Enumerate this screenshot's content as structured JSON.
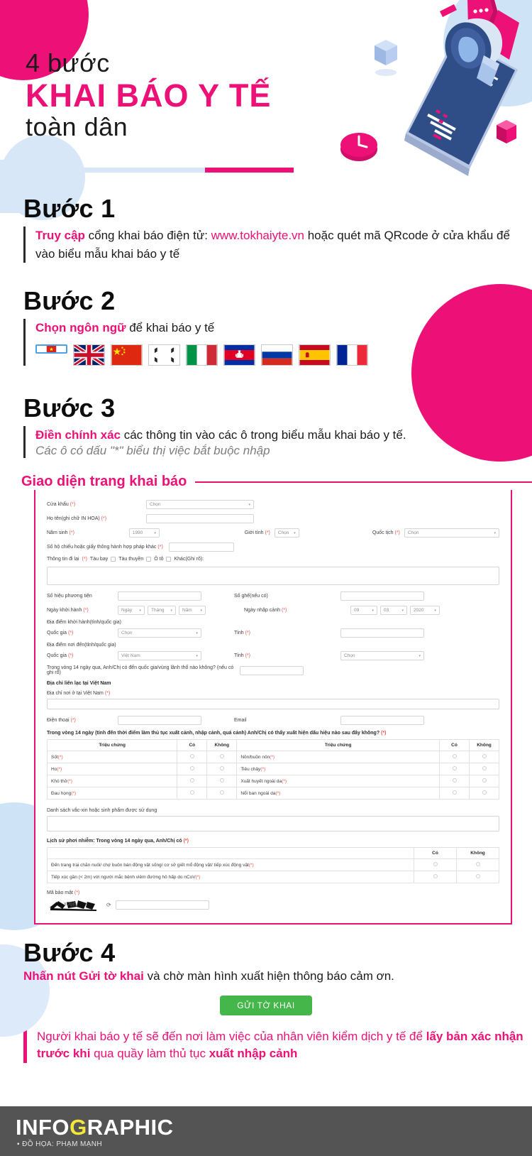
{
  "hero": {
    "line1": "4 bước",
    "line2": "KHAI BÁO Y TẾ",
    "line3": "toàn dân"
  },
  "steps": [
    {
      "title": "Bước 1",
      "lead": "Truy cập",
      "rest": " cổng khai báo điện tử: ",
      "link": "www.tokhaiyte.vn",
      "tail": " hoặc quét mã QRcode ở cửa khẩu để vào biểu mẫu khai báo y tế"
    },
    {
      "title": "Bước 2",
      "lead": "Chọn ngôn ngữ",
      "rest": " để khai báo y tế",
      "flags": [
        {
          "name": "vietnam-flag",
          "label": "Tiếng Việt",
          "selected": true
        },
        {
          "name": "uk-flag",
          "label": "English",
          "selected": false
        },
        {
          "name": "china-flag",
          "label": "中文",
          "selected": false
        },
        {
          "name": "south-korea-flag",
          "label": "한국어",
          "selected": false
        },
        {
          "name": "italy-flag",
          "label": "Italiano",
          "selected": false
        },
        {
          "name": "cambodia-flag",
          "label": "ភាសាខ្មែរ",
          "selected": false
        },
        {
          "name": "russia-flag",
          "label": "Русский",
          "selected": false
        },
        {
          "name": "spain-flag",
          "label": "Español",
          "selected": false
        },
        {
          "name": "france-flag",
          "label": "Français",
          "selected": false
        }
      ]
    },
    {
      "title": "Bước 3",
      "lead": "Điền chính xác",
      "rest": " các thông tin vào các ô trong biểu mẫu khai báo y tế.",
      "note": "Các ô có dấu \"*\" biểu thị việc bắt buộc nhập"
    },
    {
      "title": "Bước 4",
      "lead": "Nhấn nút Gửi tờ khai",
      "rest": " và chờ màn hình xuất hiện thông báo cảm ơn."
    }
  ],
  "form": {
    "heading": "Giao diện trang khai báo",
    "required_mark": "(*)",
    "fields": {
      "cua_khau_label": "Cửa khẩu",
      "cua_khau_value": "Chọn",
      "ho_ten_label": "Họ tên(ghi chữ IN HOA)",
      "ho_ten_value": "",
      "nam_sinh_label": "Năm sinh",
      "nam_sinh_value": "1990",
      "gioi_tinh_label": "Giới tính",
      "gioi_tinh_value": "Chọn",
      "quoc_tich_label": "Quốc tịch",
      "quoc_tich_value": "Chọn",
      "ho_chieu_label": "Số hộ chiếu hoặc giấy thông hành hợp pháp khác",
      "ho_chieu_value": "",
      "thong_tin_di_lai_label": "Thông tin đi lại",
      "travel_options": [
        "Tàu bay",
        "Tàu thuyền",
        "Ô tô"
      ],
      "khac_label": "Khác(Ghi rõ):",
      "so_hieu_label": "Số hiệu phương tiện",
      "so_hieu_value": "",
      "so_ghe_label": "Số ghế(nếu có)",
      "so_ghe_value": "",
      "ngay_khoi_hanh_label": "Ngày khởi hành",
      "ngay_khoi_hanh": [
        "Ngày",
        "Tháng",
        "Năm"
      ],
      "ngay_nhap_canh_label": "Ngày nhập cảnh",
      "ngay_nhap_canh": [
        "09",
        "03",
        "2020"
      ],
      "dia_diem_khoi_hanh_label": "Địa điểm khởi hành(tỉnh/quốc gia)",
      "quoc_gia_label": "Quốc gia",
      "quoc_gia_kh_value": "Chọn",
      "tinh_label": "Tỉnh",
      "tinh_kh_value": "",
      "dia_diem_noi_den_label": "Địa điểm nơi đến(tỉnh/quốc gia)",
      "quoc_gia_nd_value": "Việt Nam",
      "tinh_nd_value": "Chọn",
      "trong_vong_14_label": "Trong vòng 14 ngày qua, Anh/Chị có đến quốc gia/vùng lãnh thổ nào không? (nếu có ghi rõ)",
      "dia_chi_lien_lac_title": "Địa chỉ liên lạc tại Việt Nam",
      "dia_chi_noi_o_label": "Địa chỉ nơi ở tại Việt Nam",
      "dien_thoai_label": "Điện thoại",
      "email_label": "Email",
      "vaccine_label": "Danh sách vắc-xin hoặc sinh phẩm được sử dụng",
      "ma_bao_mat_label": "Mã bảo mật",
      "captcha_text": "xDgj5"
    },
    "symptoms_question": "Trong vòng 14 ngày (tính đến thời điểm làm thủ tục xuất cảnh, nhập cảnh, quá cảnh) Anh/Chị có thấy xuất hiện dấu hiệu nào sau đây không?",
    "symptoms_headers": [
      "Triệu chứng",
      "Có",
      "Không",
      "Triệu chứng",
      "Có",
      "Không"
    ],
    "symptoms_rows": [
      {
        "left": "Sốt",
        "right": "Nôn/buồn nôn"
      },
      {
        "left": "Ho",
        "right": "Tiêu chảy"
      },
      {
        "left": "Khó thở",
        "right": "Xuất huyết ngoài da"
      },
      {
        "left": "Đau họng",
        "right": "Nổi ban ngoài da"
      }
    ],
    "exposure_question": "Lịch sử phơi nhiễm: Trong vòng 14 ngày qua, Anh/Chị có",
    "exposure_headers": [
      "",
      "Có",
      "Không"
    ],
    "exposure_rows": [
      "Đến trang trại chăn nuôi/ chợ buôn bán động vật sống/ cơ sở giết mổ động vật/ tiếp xúc động vật",
      "Tiếp xúc gần (< 2m) với người mắc bệnh viêm đường hô hấp do nCoV"
    ]
  },
  "submit": {
    "label": "GỬI TỜ KHAI"
  },
  "footnote": {
    "part1": "Người khai báo y tế sẽ đến nơi làm việc của nhân viên kiểm dịch y tế để ",
    "bold1": "lấy bản xác nhận trước khi",
    "part2": " qua quầy làm thủ tục ",
    "bold2": "xuất nhập cảnh"
  },
  "footer": {
    "word_pre": "INFO",
    "word_accent": "G",
    "word_post": "RAPHIC",
    "credit": "ĐỒ HỌA: PHẠM MẠNH"
  },
  "colors": {
    "pink": "#ec1077",
    "lightblue": "#cfe3f7",
    "navy": "#2f4e87",
    "green": "#45b649",
    "gray": "#545454"
  }
}
